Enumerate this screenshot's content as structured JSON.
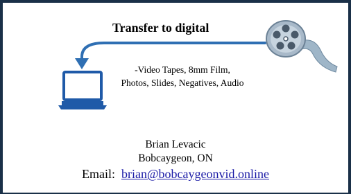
{
  "header": {
    "title": "Transfer to digital"
  },
  "services": {
    "line1": "-Video Tapes, 8mm Film,",
    "line2": "Photos, Slides, Negatives, Audio"
  },
  "contact": {
    "name": "Brian Levacic",
    "location": "Bobcaygeon, ON",
    "email_label": "Email:",
    "email": "brian@bobcaygeonvid.online"
  },
  "icons": {
    "film_reel": "film-reel-icon",
    "laptop": "laptop-icon",
    "arrow": "curved-arrow-icon"
  },
  "colors": {
    "border": "#1a3048",
    "arrow": "#2f6fb3",
    "laptop": "#1f5aa8",
    "link": "#1a1aa6"
  }
}
